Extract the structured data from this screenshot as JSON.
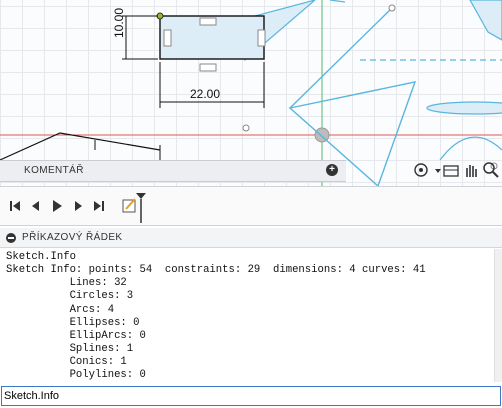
{
  "canvas": {
    "dimensions": {
      "height": "10.00",
      "width": "22.00",
      "partial": "50"
    }
  },
  "comment_bar": {
    "label": "KOMENTÁŘ",
    "add_icon": "plus-circle-icon"
  },
  "nav_toolbar": {
    "icons": [
      "orbit-icon",
      "look-at-icon",
      "pan-icon",
      "zoom-icon"
    ]
  },
  "timeline": {
    "buttons": [
      "first-icon",
      "previous-icon",
      "play-icon",
      "next-icon",
      "last-icon"
    ],
    "feature_icon": "sketch-icon"
  },
  "command_line": {
    "title": "PŘÍKAZOVÝ ŘÁDEK",
    "output": [
      "Sketch.Info",
      "Sketch Info: points: 54  constraints: 29  dimensions: 4 curves: 41",
      "          Lines: 32",
      "          Circles: 3",
      "          Arcs: 4",
      "          Ellipses: 0",
      "          EllipArcs: 0",
      "          Splines: 1",
      "          Conics: 1",
      "          Polylines: 0"
    ],
    "input_value": "Sketch.Info"
  },
  "colors": {
    "sketch_blue": "#58b6e0",
    "fill_blue": "#dcedf8",
    "axis_red": "#e05454",
    "axis_green": "#54b86a",
    "input_border": "#3a78c8"
  }
}
